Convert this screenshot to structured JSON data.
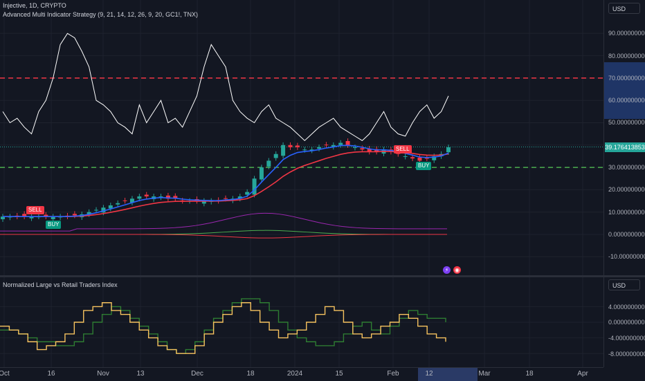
{
  "header": {
    "symbol_line": "Injective, 1D, CRYPTO",
    "strategy_line": "Advanced Multi Indicator Strategy (9, 21, 14, 12, 26, 9, 20, GC1!, TNX)"
  },
  "main_axis": {
    "currency_button": "USD",
    "labels": [
      "90.000000000",
      "80.000000000",
      "70.000000000",
      "60.000000000",
      "50.000000000",
      "40.000000000",
      "30.000000000",
      "20.000000000",
      "10.000000000",
      "0.000000000",
      "-10.000000000"
    ],
    "last_price": "39.176413853",
    "last_price_color": "#26a69a",
    "highlight_range_color": "#1f3566"
  },
  "sub_pane": {
    "title": "Normalized Large vs Retail Traders Index",
    "currency_button": "USD",
    "labels": [
      "4.000000000",
      "0.000000000",
      "-4.000000000",
      "-8.000000000"
    ],
    "line_colors": {
      "large": "#f7c35f",
      "retail": "#2e7d32"
    }
  },
  "signals": [
    {
      "label": "SELL",
      "color": "#f23645"
    },
    {
      "label": "BUY",
      "color": "#089981"
    },
    {
      "label": "SELL",
      "color": "#f23645"
    },
    {
      "label": "BUY",
      "color": "#089981"
    }
  ],
  "pane_icons": [
    {
      "name": "lightning-icon",
      "glyph": "⚡",
      "color": "#7b3ff2"
    },
    {
      "name": "emoji-icon",
      "glyph": "◉",
      "color": "#f23645"
    }
  ],
  "time_axis": {
    "labels": [
      "Oct",
      "16",
      "Nov",
      "13",
      "Dec",
      "18",
      "2024",
      "15",
      "Feb",
      "12",
      "Mar",
      "18",
      "Apr"
    ],
    "highlight_label": "12"
  },
  "colors": {
    "background": "#131722",
    "up_candle": "#26a69a",
    "down_candle": "#f23645",
    "ema_fast": "#2962ff",
    "ema_slow": "#f23645",
    "rsi_line": "#ffffff",
    "overbought_line": "#f23645",
    "oversold_line": "#4caf50",
    "macd_line": "#9c27b0",
    "signal_line": "#4caf50",
    "hist_line": "#f23645"
  },
  "chart_data": {
    "type": "line",
    "levels": {
      "overbought": 70,
      "oversold": 30
    },
    "price_close": [
      8,
      8,
      8,
      8,
      8,
      8,
      8,
      8,
      8,
      8,
      8.5,
      9,
      10,
      11,
      12,
      13,
      14,
      15,
      16,
      17,
      17,
      17,
      17,
      16,
      16,
      15,
      15,
      15,
      15,
      15,
      15,
      16,
      16,
      17,
      19,
      25,
      30,
      33,
      36,
      40,
      39,
      39,
      38,
      38,
      39,
      40,
      40,
      41,
      40,
      39,
      38,
      37,
      37,
      38,
      37,
      36,
      35,
      34,
      33,
      34,
      35,
      36,
      39
    ],
    "rsi": [
      55,
      50,
      52,
      48,
      45,
      55,
      60,
      70,
      85,
      90,
      88,
      82,
      75,
      60,
      58,
      55,
      50,
      48,
      45,
      58,
      50,
      55,
      60,
      50,
      52,
      48,
      55,
      62,
      75,
      85,
      80,
      75,
      60,
      55,
      52,
      50,
      55,
      58,
      52,
      50,
      48,
      45,
      42,
      45,
      48,
      50,
      52,
      48,
      46,
      44,
      42,
      45,
      50,
      55,
      48,
      45,
      44,
      50,
      55,
      58,
      52,
      55,
      62
    ],
    "large_index": [
      -1,
      -2,
      -3,
      -5,
      -7,
      -6,
      -5,
      -3,
      0,
      3,
      4,
      5,
      3,
      2,
      0,
      -2,
      -4,
      -6,
      -7,
      -8,
      -8,
      -6,
      -3,
      0,
      2,
      4,
      5,
      3,
      0,
      -2,
      -4,
      -3,
      -2,
      0,
      2,
      4,
      3,
      0,
      -3,
      -4,
      -3,
      -1,
      0,
      2,
      1,
      -1,
      -3,
      -4,
      -5
    ],
    "retail_index": [
      -2,
      -2,
      -3,
      -4,
      -5,
      -5,
      -6,
      -6,
      -5,
      -3,
      0,
      2,
      4,
      3,
      1,
      -1,
      -3,
      -5,
      -7,
      -8,
      -7,
      -5,
      -2,
      1,
      3,
      5,
      6,
      6,
      5,
      3,
      0,
      -2,
      -4,
      -5,
      -6,
      -6,
      -5,
      -3,
      -1,
      0,
      -2,
      -3,
      -1,
      1,
      3,
      2,
      1,
      1,
      0
    ]
  }
}
